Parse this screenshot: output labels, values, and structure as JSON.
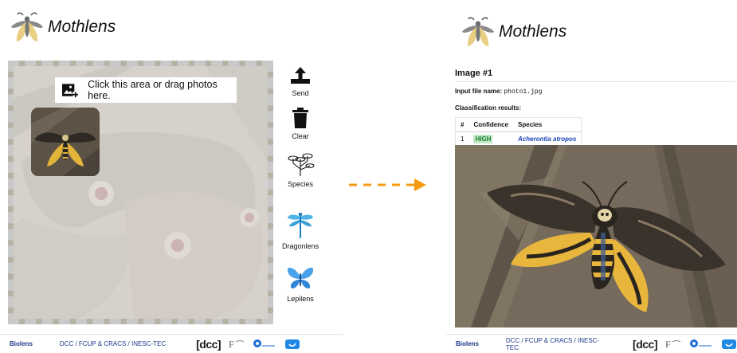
{
  "app": {
    "title": "Mothlens"
  },
  "upload": {
    "hint": "Click this area or drag photos here."
  },
  "actions": {
    "send": "Send",
    "clear": "Clear",
    "species": "Species",
    "dragonlens": "Dragonlens",
    "lepilens": "Lepilens"
  },
  "result": {
    "image_title": "Image #1",
    "file_label": "Input file name:",
    "file_name": "photo1.jpg",
    "classification_title": "Classification results:",
    "columns": [
      "#",
      "Confidence",
      "Species"
    ],
    "rows": [
      {
        "rank": "1",
        "confidence": "HIGH",
        "species": "Acherontia atropos"
      }
    ]
  },
  "footer": {
    "brand": "Biolens",
    "org": "DCC / FCUP & CRACS / INESC-TEC",
    "dcc_logo": "[dcc]"
  },
  "colors": {
    "accent_arrow": "#f39c12",
    "confidence_high_bg": "#bfe9c5",
    "confidence_high_text": "#1e7a2e",
    "species_link": "#1c45b5",
    "footer_text": "#1e3a8a"
  },
  "icons": {
    "logo": "moth-logo-icon",
    "send": "upload-tray-icon",
    "clear": "trash-icon",
    "species": "tree-diagram-icon",
    "dragonlens": "dragonfly-icon",
    "lepilens": "butterfly-icon",
    "drop": "add-photo-icon"
  }
}
